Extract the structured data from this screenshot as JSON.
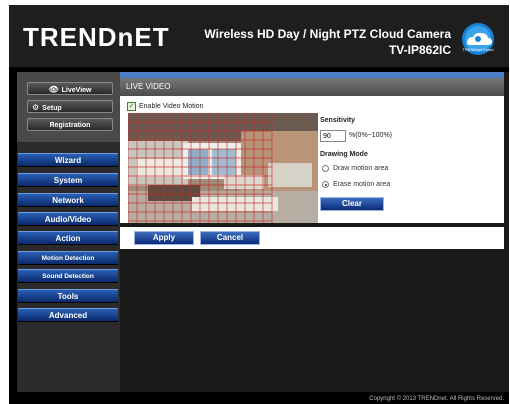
{
  "header": {
    "logo": "TRENDnET",
    "product_title": "Wireless HD Day / Night PTZ Cloud Camera",
    "model": "TV-IP862IC",
    "badge": "TRENDnet Cloud"
  },
  "sidebar": {
    "top_buttons": [
      {
        "label": "LiveView",
        "icon": "eye-icon"
      },
      {
        "label": "Setup",
        "icon": "gear-icon"
      },
      {
        "label": "Registration",
        "icon": ""
      }
    ],
    "menu": [
      {
        "label": "Wizard"
      },
      {
        "label": "System"
      },
      {
        "label": "Network"
      },
      {
        "label": "Audio/Video"
      },
      {
        "label": "Action"
      },
      {
        "label": "Motion Detection"
      },
      {
        "label": "Sound Detection"
      },
      {
        "label": "Tools"
      },
      {
        "label": "Advanced"
      }
    ]
  },
  "main": {
    "panel_title": "LIVE VIDEO",
    "enable_label": "Enable Video Motion",
    "enable_checked": true,
    "sensitivity_label": "Sensitivity",
    "sensitivity_value": "90",
    "sensitivity_range": "%(0%~100%)",
    "drawing_mode_label": "Drawing Mode",
    "draw_option": "Draw motion area",
    "erase_option": "Erase motion area",
    "selected_mode": "erase",
    "clear_label": "Clear",
    "apply_label": "Apply",
    "cancel_label": "Cancel"
  },
  "footer": {
    "copyright": "Copyright © 2013 TRENDnet. All Rights Reserved."
  },
  "colors": {
    "menu_blue": "#1a4aa0",
    "motion_grid": "#cc2a2a"
  }
}
